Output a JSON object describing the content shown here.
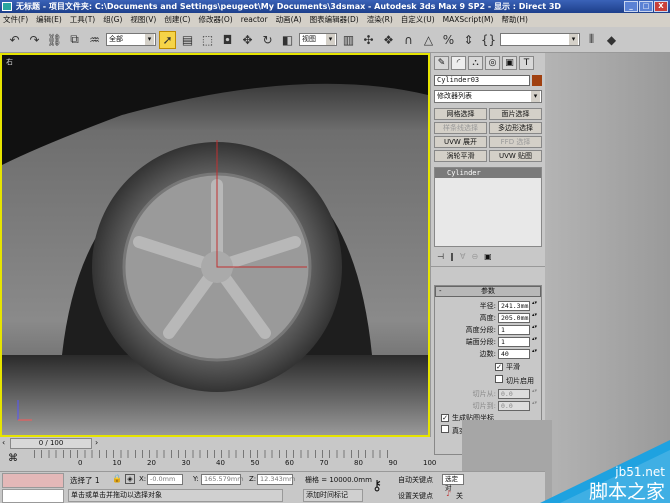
{
  "title": "无标题   - 项目文件夹: C:\\Documents and Settings\\peugeot\\My Documents\\3dsmax   - Autodesk 3ds Max 9 SP2   - 显示 : Direct 3D",
  "window_buttons": [
    "_",
    "□",
    "X"
  ],
  "menu": [
    "文件(F)",
    "编辑(E)",
    "工具(T)",
    "组(G)",
    "视图(V)",
    "创建(C)",
    "修改器(O)",
    "reactor",
    "动画(A)",
    "图表编辑器(D)",
    "渲染(R)",
    "自定义(U)",
    "MAXScript(M)",
    "帮助(H)"
  ],
  "toolbar": {
    "selection_filter": "全部",
    "coord_system": "视图",
    "named_selection": ""
  },
  "viewport": {
    "label": "右",
    "accent": "#e6e400"
  },
  "cmd": {
    "object_name": "Cylinder03",
    "object_color": "#a04010",
    "modifier_list": "修改器列表",
    "buttons": [
      {
        "label": "网格选择",
        "enabled": true
      },
      {
        "label": "面片选择",
        "enabled": true
      },
      {
        "label": "样条线选择",
        "enabled": false
      },
      {
        "label": "多边形选择",
        "enabled": true
      },
      {
        "label": "UVW 展开",
        "enabled": true
      },
      {
        "label": "FFD 选择",
        "enabled": false
      },
      {
        "label": "涡轮平滑",
        "enabled": true
      },
      {
        "label": "UVW 贴图",
        "enabled": true
      }
    ],
    "stack_item": "Cylinder",
    "rollout_title": "参数",
    "rollout_toggle": "-",
    "params": [
      {
        "label": "半径:",
        "value": "241.3mm"
      },
      {
        "label": "高度:",
        "value": "205.0mm"
      },
      {
        "label": "高度分段:",
        "value": "1"
      },
      {
        "label": "端面分段:",
        "value": "1"
      },
      {
        "label": "边数:",
        "value": "40"
      }
    ],
    "smooth": {
      "label": "平滑",
      "checked": true
    },
    "slice_on": {
      "label": "切片启用",
      "checked": false
    },
    "slice_params": [
      {
        "label": "切片从:",
        "value": "0.0"
      },
      {
        "label": "切片到:",
        "value": "0.0"
      }
    ],
    "gen_map": {
      "label": "生成贴图坐标",
      "checked": true
    },
    "real_world": {
      "label": "真实",
      "checked": false
    }
  },
  "time": {
    "slider": "0 / 100",
    "ticks": [
      "0",
      "10",
      "20",
      "30",
      "40",
      "50",
      "60",
      "70",
      "80",
      "90",
      "100"
    ]
  },
  "status": {
    "selected": "选择了 1",
    "x_label": "X:",
    "x": "-0.0mm",
    "y_label": "Y:",
    "y": "165.579mm",
    "z_label": "Z:",
    "z": "12.343mm",
    "grid": "栅格 = 10000.0mm",
    "prompt": "单击或单击并拖动以选择对象",
    "add_time_tag": "添加时间标记",
    "auto_key": "自动关键点",
    "set_key": "设置关键点",
    "selected_set": "选定对",
    "key_filter": "关"
  },
  "watermark": {
    "site": "jb51.net",
    "name": "脚本之家"
  }
}
